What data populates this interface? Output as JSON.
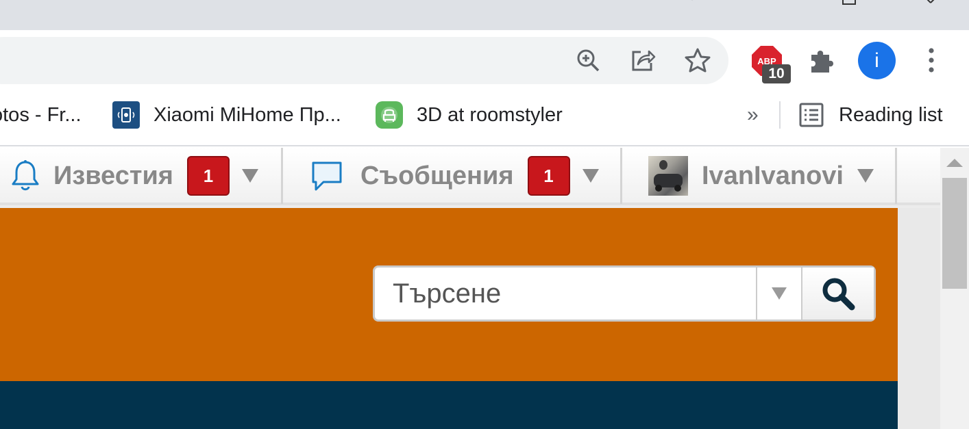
{
  "browser": {
    "extensions": {
      "abp_badge": "10",
      "profile_initial": "i"
    },
    "bookmarks": [
      {
        "label": "otos - Fr..."
      },
      {
        "label": "Xiaomi MiHome Пр..."
      },
      {
        "label": "3D at roomstyler"
      }
    ],
    "overflow_label": "»",
    "reading_list_label": "Reading list"
  },
  "nav": {
    "notifications": {
      "label": "Известия",
      "count": "1"
    },
    "messages": {
      "label": "Съобщения",
      "count": "1"
    },
    "user": {
      "name": "IvanIvanovi"
    }
  },
  "search": {
    "placeholder": "Търсене"
  },
  "colors": {
    "banner": "#cc6600",
    "footer": "#02334d",
    "badge": "#c8171c",
    "profile": "#1a73e8"
  }
}
